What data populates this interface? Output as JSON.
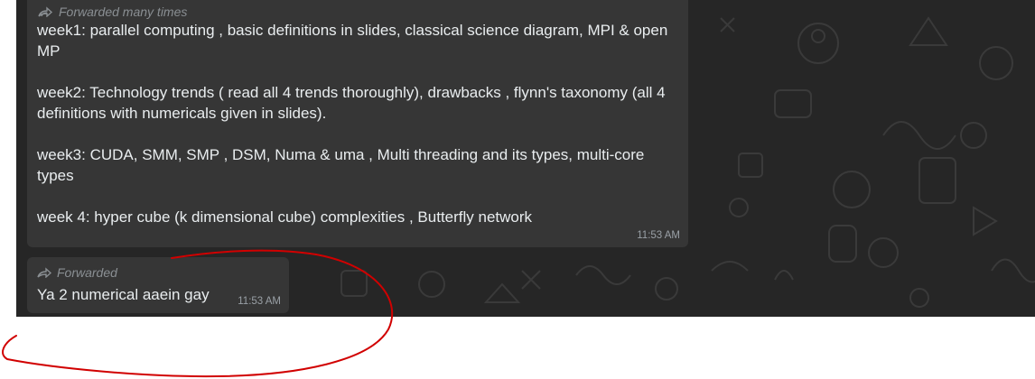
{
  "messages": [
    {
      "forwarded_label": "Forwarded many times",
      "paragraphs": [
        "week1: parallel computing , basic definitions in slides, classical science diagram, MPI & open MP",
        "week2: Technology trends ( read all 4 trends thoroughly), drawbacks , flynn's taxonomy (all 4 definitions with numericals given in slides).",
        "week3: CUDA, SMM, SMP , DSM, Numa & uma , Multi threading and its types, multi-core types",
        "week 4: hyper cube (k dimensional cube) complexities , Butterfly network"
      ],
      "time": "11:53 AM",
      "icon": "forwarded-many-times-icon"
    },
    {
      "forwarded_label": "Forwarded",
      "text": "Ya 2 numerical aaein gay",
      "time": "11:53 AM",
      "icon": "forwarded-icon"
    }
  ],
  "colors": {
    "chat_background": "#262626",
    "bubble": "#363636",
    "text": "#e9edef",
    "meta": "#8a8f93",
    "annotation": "#d10000"
  }
}
